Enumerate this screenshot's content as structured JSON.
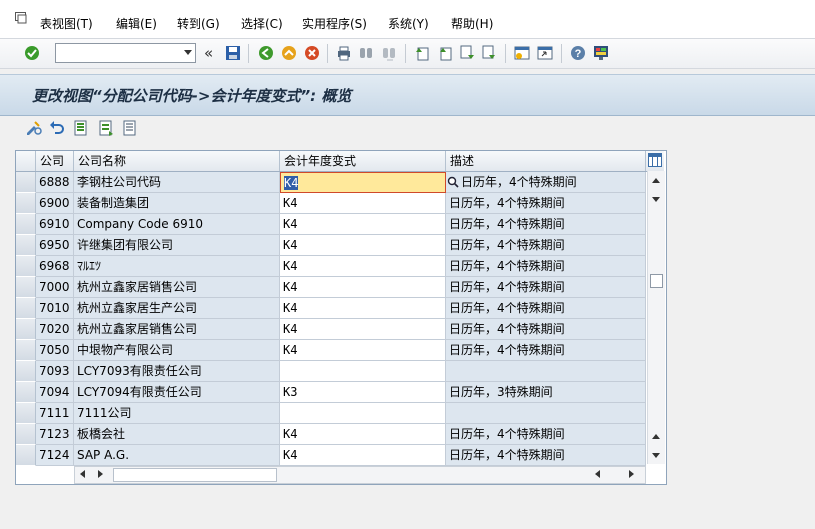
{
  "menubar": {
    "items": [
      {
        "label": "表视图(T)"
      },
      {
        "label": "编辑(E)"
      },
      {
        "label": "转到(G)"
      },
      {
        "label": "选择(C)"
      },
      {
        "label": "实用程序(S)"
      },
      {
        "label": "系统(Y)"
      },
      {
        "label": "帮助(H)"
      }
    ]
  },
  "toolbar": {
    "command_field_value": "",
    "icons": [
      "enter-icon",
      "command-field",
      "back-arrows-icon",
      "save-icon",
      "back-icon",
      "exit-icon",
      "cancel-icon",
      "print-icon",
      "find-icon",
      "find-next-icon",
      "first-page-icon",
      "previous-page-icon",
      "next-page-icon",
      "last-page-icon",
      "new-session-icon",
      "shortcut-icon",
      "help-icon",
      "customize-layout-icon"
    ]
  },
  "title": {
    "text": "更改视图“分配公司代码->会计年度变式”: 概览"
  },
  "app_toolbar": {
    "icons": [
      "display-change-icon",
      "undo-icon",
      "select-all-icon",
      "select-block-icon",
      "deselect-all-icon"
    ]
  },
  "table": {
    "columns": [
      "公司",
      "公司名称",
      "会计年度变式",
      "描述"
    ],
    "rows": [
      {
        "code": "6888",
        "name": "李钢柱公司代码",
        "variant": "K4",
        "desc": "日历年，4个特殊期间",
        "focused": true
      },
      {
        "code": "6900",
        "name": "装备制造集团",
        "variant": "K4",
        "desc": "日历年，4个特殊期间"
      },
      {
        "code": "6910",
        "name": "Company Code 6910",
        "variant": "K4",
        "desc": "日历年，4个特殊期间"
      },
      {
        "code": "6950",
        "name": "许继集团有限公司",
        "variant": "K4",
        "desc": "日历年，4个特殊期间"
      },
      {
        "code": "6968",
        "name": "ﾏﾙｴﾂ",
        "variant": "K4",
        "desc": "日历年，4个特殊期间"
      },
      {
        "code": "7000",
        "name": "杭州立鑫家居销售公司",
        "variant": "K4",
        "desc": "日历年，4个特殊期间"
      },
      {
        "code": "7010",
        "name": "杭州立鑫家居生产公司",
        "variant": "K4",
        "desc": "日历年，4个特殊期间"
      },
      {
        "code": "7020",
        "name": "杭州立鑫家居销售公司",
        "variant": "K4",
        "desc": "日历年，4个特殊期间"
      },
      {
        "code": "7050",
        "name": "中垠物产有限公司",
        "variant": "K4",
        "desc": "日历年，4个特殊期间"
      },
      {
        "code": "7093",
        "name": "LCY7093有限责任公司",
        "variant": "",
        "desc": ""
      },
      {
        "code": "7094",
        "name": "LCY7094有限责任公司",
        "variant": "K3",
        "desc": "日历年，3特殊期间"
      },
      {
        "code": "7111",
        "name": "7111公司",
        "variant": "",
        "desc": ""
      },
      {
        "code": "7123",
        "name": "板橋会社",
        "variant": "K4",
        "desc": "日历年，4个特殊期间"
      },
      {
        "code": "7124",
        "name": "SAP A.G.",
        "variant": "K4",
        "desc": "日历年，4个特殊期间"
      }
    ]
  },
  "colors": {
    "title_bg": "#c9d9e8",
    "readonly_cell": "#dde6ef",
    "focus_cell": "#ffe99b",
    "selection": "#315ea8"
  }
}
